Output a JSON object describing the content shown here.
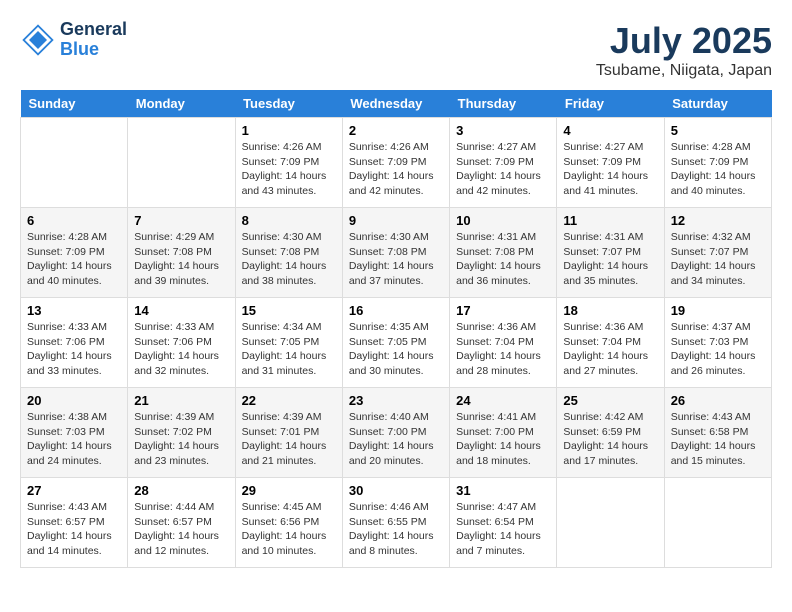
{
  "header": {
    "logo_line1": "General",
    "logo_line2": "Blue",
    "month": "July 2025",
    "location": "Tsubame, Niigata, Japan"
  },
  "weekdays": [
    "Sunday",
    "Monday",
    "Tuesday",
    "Wednesday",
    "Thursday",
    "Friday",
    "Saturday"
  ],
  "weeks": [
    [
      {
        "day": "",
        "info": ""
      },
      {
        "day": "",
        "info": ""
      },
      {
        "day": "1",
        "info": "Sunrise: 4:26 AM\nSunset: 7:09 PM\nDaylight: 14 hours and 43 minutes."
      },
      {
        "day": "2",
        "info": "Sunrise: 4:26 AM\nSunset: 7:09 PM\nDaylight: 14 hours and 42 minutes."
      },
      {
        "day": "3",
        "info": "Sunrise: 4:27 AM\nSunset: 7:09 PM\nDaylight: 14 hours and 42 minutes."
      },
      {
        "day": "4",
        "info": "Sunrise: 4:27 AM\nSunset: 7:09 PM\nDaylight: 14 hours and 41 minutes."
      },
      {
        "day": "5",
        "info": "Sunrise: 4:28 AM\nSunset: 7:09 PM\nDaylight: 14 hours and 40 minutes."
      }
    ],
    [
      {
        "day": "6",
        "info": "Sunrise: 4:28 AM\nSunset: 7:09 PM\nDaylight: 14 hours and 40 minutes."
      },
      {
        "day": "7",
        "info": "Sunrise: 4:29 AM\nSunset: 7:08 PM\nDaylight: 14 hours and 39 minutes."
      },
      {
        "day": "8",
        "info": "Sunrise: 4:30 AM\nSunset: 7:08 PM\nDaylight: 14 hours and 38 minutes."
      },
      {
        "day": "9",
        "info": "Sunrise: 4:30 AM\nSunset: 7:08 PM\nDaylight: 14 hours and 37 minutes."
      },
      {
        "day": "10",
        "info": "Sunrise: 4:31 AM\nSunset: 7:08 PM\nDaylight: 14 hours and 36 minutes."
      },
      {
        "day": "11",
        "info": "Sunrise: 4:31 AM\nSunset: 7:07 PM\nDaylight: 14 hours and 35 minutes."
      },
      {
        "day": "12",
        "info": "Sunrise: 4:32 AM\nSunset: 7:07 PM\nDaylight: 14 hours and 34 minutes."
      }
    ],
    [
      {
        "day": "13",
        "info": "Sunrise: 4:33 AM\nSunset: 7:06 PM\nDaylight: 14 hours and 33 minutes."
      },
      {
        "day": "14",
        "info": "Sunrise: 4:33 AM\nSunset: 7:06 PM\nDaylight: 14 hours and 32 minutes."
      },
      {
        "day": "15",
        "info": "Sunrise: 4:34 AM\nSunset: 7:05 PM\nDaylight: 14 hours and 31 minutes."
      },
      {
        "day": "16",
        "info": "Sunrise: 4:35 AM\nSunset: 7:05 PM\nDaylight: 14 hours and 30 minutes."
      },
      {
        "day": "17",
        "info": "Sunrise: 4:36 AM\nSunset: 7:04 PM\nDaylight: 14 hours and 28 minutes."
      },
      {
        "day": "18",
        "info": "Sunrise: 4:36 AM\nSunset: 7:04 PM\nDaylight: 14 hours and 27 minutes."
      },
      {
        "day": "19",
        "info": "Sunrise: 4:37 AM\nSunset: 7:03 PM\nDaylight: 14 hours and 26 minutes."
      }
    ],
    [
      {
        "day": "20",
        "info": "Sunrise: 4:38 AM\nSunset: 7:03 PM\nDaylight: 14 hours and 24 minutes."
      },
      {
        "day": "21",
        "info": "Sunrise: 4:39 AM\nSunset: 7:02 PM\nDaylight: 14 hours and 23 minutes."
      },
      {
        "day": "22",
        "info": "Sunrise: 4:39 AM\nSunset: 7:01 PM\nDaylight: 14 hours and 21 minutes."
      },
      {
        "day": "23",
        "info": "Sunrise: 4:40 AM\nSunset: 7:00 PM\nDaylight: 14 hours and 20 minutes."
      },
      {
        "day": "24",
        "info": "Sunrise: 4:41 AM\nSunset: 7:00 PM\nDaylight: 14 hours and 18 minutes."
      },
      {
        "day": "25",
        "info": "Sunrise: 4:42 AM\nSunset: 6:59 PM\nDaylight: 14 hours and 17 minutes."
      },
      {
        "day": "26",
        "info": "Sunrise: 4:43 AM\nSunset: 6:58 PM\nDaylight: 14 hours and 15 minutes."
      }
    ],
    [
      {
        "day": "27",
        "info": "Sunrise: 4:43 AM\nSunset: 6:57 PM\nDaylight: 14 hours and 14 minutes."
      },
      {
        "day": "28",
        "info": "Sunrise: 4:44 AM\nSunset: 6:57 PM\nDaylight: 14 hours and 12 minutes."
      },
      {
        "day": "29",
        "info": "Sunrise: 4:45 AM\nSunset: 6:56 PM\nDaylight: 14 hours and 10 minutes."
      },
      {
        "day": "30",
        "info": "Sunrise: 4:46 AM\nSunset: 6:55 PM\nDaylight: 14 hours and 8 minutes."
      },
      {
        "day": "31",
        "info": "Sunrise: 4:47 AM\nSunset: 6:54 PM\nDaylight: 14 hours and 7 minutes."
      },
      {
        "day": "",
        "info": ""
      },
      {
        "day": "",
        "info": ""
      }
    ]
  ]
}
